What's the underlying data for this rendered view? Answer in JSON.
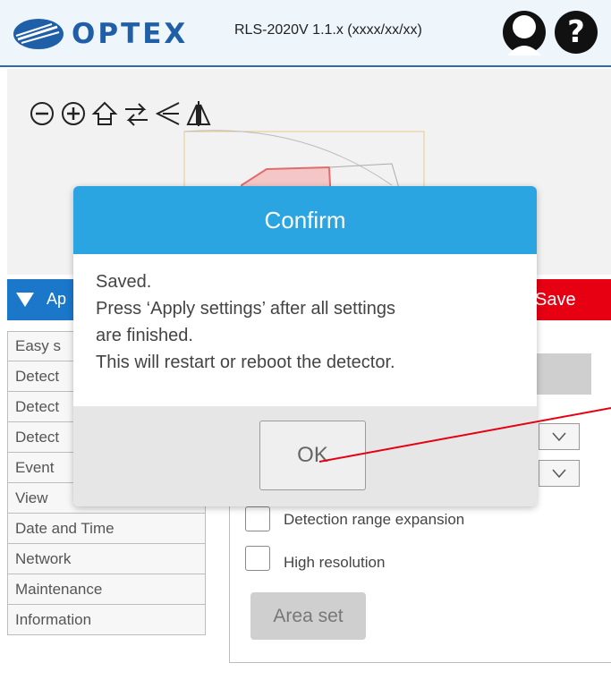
{
  "header": {
    "brand": "OPTEX",
    "model": "RLS-2020V 1.1.x (xxxx/xx/xx)"
  },
  "toolbar": {
    "icons": [
      "zoom-out-icon",
      "zoom-in-icon",
      "home-icon",
      "swap-icon",
      "flip-horizontal-icon",
      "mirror-icon"
    ]
  },
  "apply": {
    "label": "Ap"
  },
  "save": {
    "label": "Save"
  },
  "sidebar": {
    "items": [
      {
        "label": "Easy s"
      },
      {
        "label": "Detect"
      },
      {
        "label": "Detect"
      },
      {
        "label": "Detect"
      },
      {
        "label": "Event"
      },
      {
        "label": "View"
      },
      {
        "label": "Date and Time"
      },
      {
        "label": "Network"
      },
      {
        "label": "Maintenance"
      },
      {
        "label": "Information"
      }
    ]
  },
  "panel": {
    "option1": "Detection range expansion",
    "option2": "High resolution",
    "area_set": "Area set"
  },
  "dialog": {
    "title": "Confirm",
    "lines": [
      "Saved.",
      "Press ‘Apply settings’ after all settings",
      "are finished.",
      "This will restart or reboot the detector."
    ],
    "ok": "OK"
  },
  "colors": {
    "accent": "#1b77c9",
    "dialog_header": "#2ba5e2",
    "save": "#e60012",
    "pointer_line": "#e60012"
  }
}
